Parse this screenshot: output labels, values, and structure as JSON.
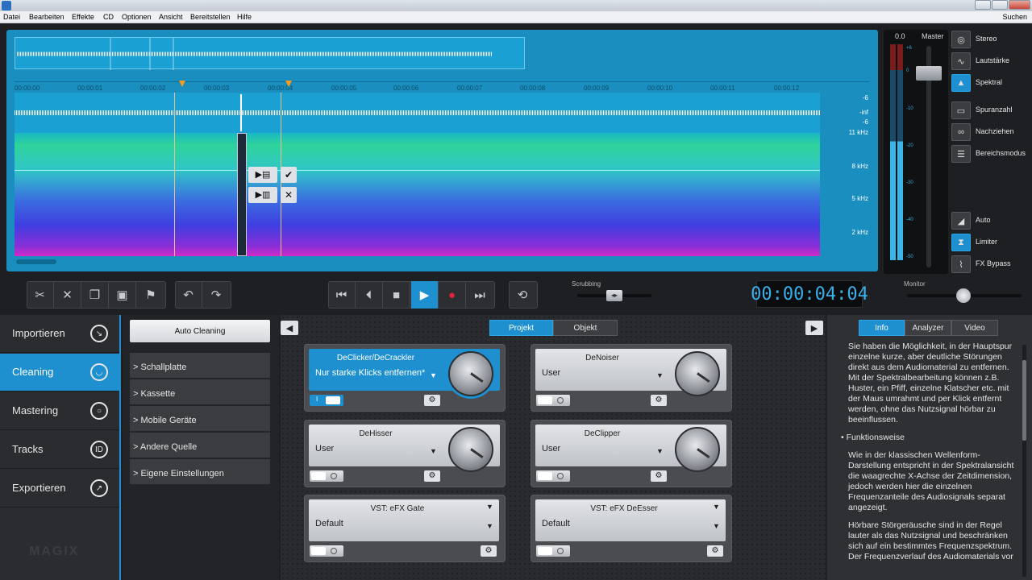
{
  "menu": [
    "Datei",
    "Bearbeiten",
    "Effekte",
    "CD",
    "Optionen",
    "Ansicht",
    "Bereitstellen",
    "Hilfe"
  ],
  "search_label": "Suchen",
  "timeline": {
    "ticks": [
      "00:00:00",
      "00:00:01",
      "00:00:02",
      "00:00:03",
      "00:00:04",
      "00:00:05",
      "00:00:06",
      "00:00:07",
      "00:00:08",
      "00:00:09",
      "00:00:10",
      "00:00:11",
      "00:00:12"
    ],
    "level_labels": [
      "-6",
      "-inf",
      "-6"
    ],
    "freq_labels": [
      "11 kHz",
      "8 kHz",
      "5 kHz",
      "2 kHz"
    ]
  },
  "meter": {
    "value": "0.0",
    "master_label": "Master",
    "scale": [
      "+6",
      "0",
      "-10",
      "-20",
      "-30",
      "-40",
      "-50"
    ]
  },
  "view_toggles": [
    {
      "label": "Stereo",
      "icon": "stereo-icon",
      "active": false
    },
    {
      "label": "Lautstärke",
      "icon": "volume-curve-icon",
      "active": false
    },
    {
      "label": "Spektral",
      "icon": "spectral-icon",
      "active": true
    },
    {
      "label": "Spuranzahl",
      "icon": "track-count-icon",
      "active": false
    },
    {
      "label": "Nachziehen",
      "icon": "link-icon",
      "active": false
    },
    {
      "label": "Bereichsmodus",
      "icon": "range-mode-icon",
      "active": false
    },
    {
      "label": "Auto",
      "icon": "auto-icon",
      "active": false
    },
    {
      "label": "Limiter",
      "icon": "limiter-icon",
      "active": true
    },
    {
      "label": "FX Bypass",
      "icon": "fx-bypass-icon",
      "active": false
    }
  ],
  "transport": {
    "scrubbing_label": "Scrubbing",
    "timecode": "00:00:04:04",
    "monitor_label": "Monitor"
  },
  "nav": [
    {
      "label": "Importieren",
      "icon": "import-icon",
      "glyph": "↘",
      "active": false
    },
    {
      "label": "Cleaning",
      "icon": "cleaning-icon",
      "glyph": "◡",
      "active": true
    },
    {
      "label": "Mastering",
      "icon": "mastering-icon",
      "glyph": "○",
      "active": false
    },
    {
      "label": "Tracks",
      "icon": "tracks-icon",
      "glyph": "ID",
      "active": false
    },
    {
      "label": "Exportieren",
      "icon": "export-icon",
      "glyph": "↗",
      "active": false
    }
  ],
  "logo": "MAGIX",
  "presets": {
    "auto_cleaning": "Auto Cleaning",
    "items": [
      "> Schallplatte",
      "> Kassette",
      "> Mobile Geräte",
      "> Andere Quelle",
      "> Eigene Einstellungen"
    ]
  },
  "fx_tabs": [
    "Projekt",
    "Objekt"
  ],
  "fx": [
    {
      "title": "DeClicker/DeCrackler",
      "preset": "Nur starke Klicks entfernen*",
      "active": true
    },
    {
      "title": "DeNoiser",
      "preset": "User",
      "active": false
    },
    {
      "title": "DeHisser",
      "preset": "User",
      "active": false
    },
    {
      "title": "DeClipper",
      "preset": "User",
      "active": false
    },
    {
      "title": "VST: eFX Gate",
      "preset": "Default",
      "active": false
    },
    {
      "title": "VST: eFX DeEsser",
      "preset": "Default",
      "active": false
    }
  ],
  "toggle_on_label": "I",
  "info_tabs": [
    "Info",
    "Analyzer",
    "Video"
  ],
  "info": {
    "p1": "Sie haben die Möglichkeit, in der Hauptspur einzelne kurze, aber deutliche Störungen direkt aus dem Audiomaterial zu entfernen. Mit der Spektralbearbeitung können z.B. Huster, ein Pfiff, einzelne Klatscher etc. mit der Maus umrahmt und per Klick entfernt werden, ohne das Nutzsignal hörbar zu beeinflussen.",
    "heading": "• Funktionsweise",
    "p2": "Wie in der klassischen Wellenform-Darstellung entspricht in der Spektralansicht die waagrechte X-Achse der Zeitdimension, jedoch werden hier die einzelnen Frequenzanteile des Audiosignals separat angezeigt.",
    "p3": "Hörbare Störgeräusche sind in der Regel lauter als das Nutzsignal und beschränken sich auf ein bestimmtes Frequenzspektrum. Der Frequenzverlauf des Audiomaterials vor"
  }
}
